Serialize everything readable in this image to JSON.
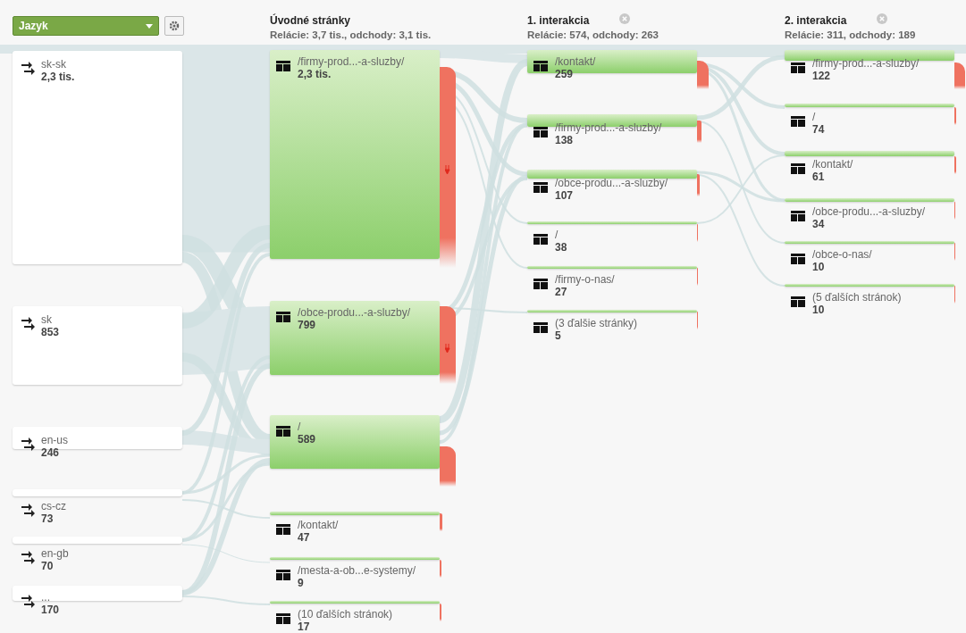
{
  "dimension_selector": {
    "label": "Jazyk"
  },
  "sources": [
    {
      "label": "sk-sk",
      "count": "2,3 tis."
    },
    {
      "label": "sk",
      "count": "853"
    },
    {
      "label": "en-us",
      "count": "246"
    },
    {
      "label": "cs-cz",
      "count": "73"
    },
    {
      "label": "en-gb",
      "count": "70"
    },
    {
      "label": "...",
      "count": "170"
    }
  ],
  "columns": [
    {
      "title": "Úvodné stránky",
      "summary": "Relácie: 3,7 tis., odchody: 3,1 tis.",
      "closable": false,
      "nodes": [
        {
          "page": "/firmy-prod...-a-sluzby/",
          "count": "2,3 tis."
        },
        {
          "page": "/obce-produ...-a-sluzby/",
          "count": "799"
        },
        {
          "page": "/",
          "count": "589"
        },
        {
          "page": "/kontakt/",
          "count": "47"
        },
        {
          "page": "/mesta-a-ob...e-systemy/",
          "count": "9"
        },
        {
          "page": "(10 ďalších stránok)",
          "count": "17"
        }
      ]
    },
    {
      "title": "1. interakcia",
      "summary": "Relácie: 574, odchody: 263",
      "closable": true,
      "nodes": [
        {
          "page": "/kontakt/",
          "count": "259"
        },
        {
          "page": "/firmy-prod...-a-sluzby/",
          "count": "138"
        },
        {
          "page": "/obce-produ...-a-sluzby/",
          "count": "107"
        },
        {
          "page": "/",
          "count": "38"
        },
        {
          "page": "/firmy-o-nas/",
          "count": "27"
        },
        {
          "page": "(3 ďalšie stránky)",
          "count": "5"
        }
      ]
    },
    {
      "title": "2. interakcia",
      "summary": "Relácie: 311, odchody: 189",
      "closable": true,
      "nodes": [
        {
          "page": "/firmy-prod...-a-sluzby/",
          "count": "122"
        },
        {
          "page": "/",
          "count": "74"
        },
        {
          "page": "/kontakt/",
          "count": "61"
        },
        {
          "page": "/obce-produ...-a-sluzby/",
          "count": "34"
        },
        {
          "page": "/obce-o-nas/",
          "count": "10"
        },
        {
          "page": "(5 ďalších stránok)",
          "count": "10"
        }
      ]
    }
  ]
}
